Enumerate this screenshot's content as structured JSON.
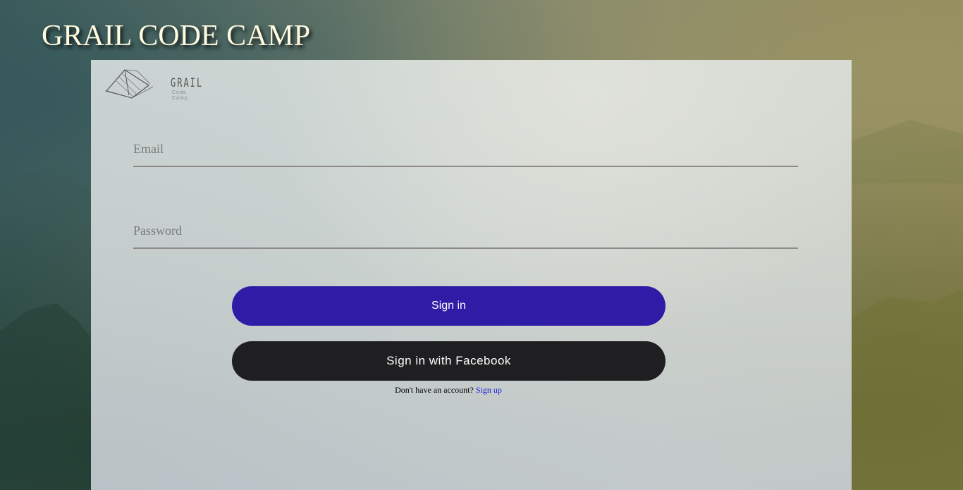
{
  "site": {
    "title": "GRAIL CODE CAMP"
  },
  "logo": {
    "icon": "tent-icon",
    "word": "GRAIL",
    "sub": "Code Camp"
  },
  "form": {
    "email_placeholder": "Email",
    "email_value": "",
    "password_placeholder": "Password",
    "password_value": ""
  },
  "buttons": {
    "signin_label": "Sign in",
    "facebook_label": "Sign in with Facebook"
  },
  "signup": {
    "prompt": "Don't have an account?",
    "link_label": "Sign up"
  },
  "colors": {
    "signin_button": "#2e1ca6",
    "facebook_button": "#1f1f21",
    "link": "#1b19d8",
    "title": "#fffbe0"
  }
}
